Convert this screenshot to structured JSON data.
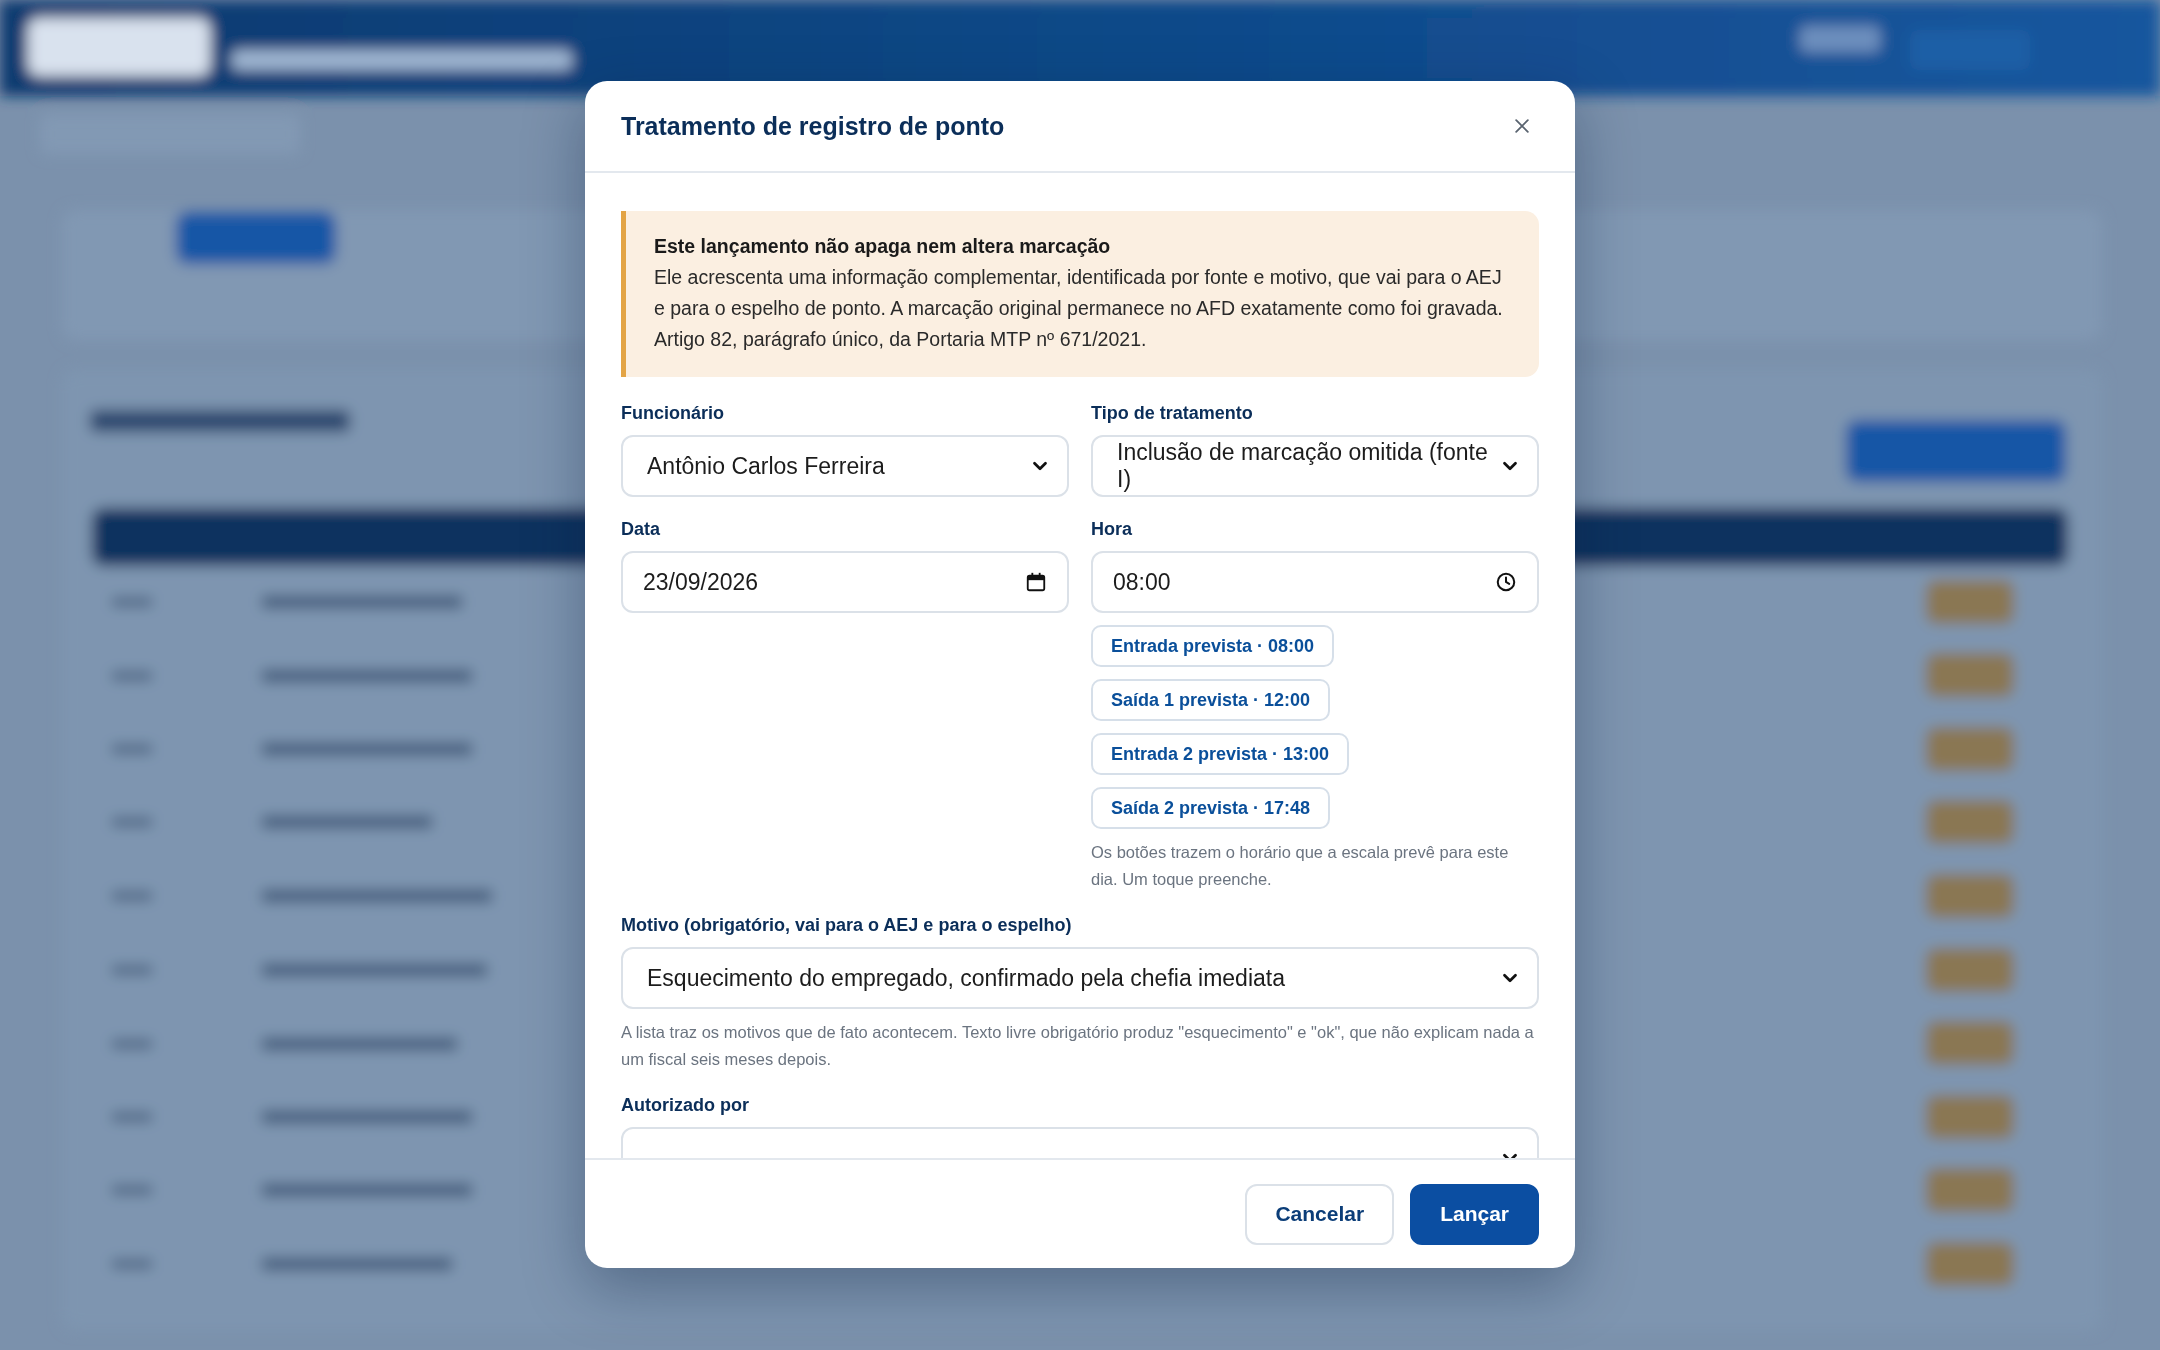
{
  "dialog": {
    "title": "Tratamento de registro de ponto"
  },
  "notice": {
    "title": "Este lançamento não apaga nem altera marcação",
    "text": "Ele acrescenta uma informação complementar, identificada por fonte e motivo, que vai para o AEJ e para o espelho de ponto. A marcação original permanece no AFD exatamente como foi gravada. Artigo 82, parágrafo único, da Portaria MTP nº 671/2021."
  },
  "rows": [
    [
      {
        "kind": "select",
        "label": "Funcionário",
        "value": "Antônio Carlos Ferreira"
      },
      {
        "kind": "select",
        "label": "Tipo de tratamento",
        "value": "Inclusão de marcação omitida (fonte I)"
      }
    ],
    [
      {
        "kind": "date",
        "label": "Data",
        "value": "23/09/2026"
      },
      {
        "kind": "time",
        "label": "Hora",
        "value": "08:00",
        "suggestions": [
          "Entrada prevista · 08:00",
          "Saída 1 prevista · 12:00",
          "Entrada 2 prevista · 13:00",
          "Saída 2 prevista · 17:48"
        ],
        "hint": "Os botões trazem o horário que a escala prevê para este dia. Um toque preenche."
      }
    ],
    [
      {
        "kind": "select",
        "label": "Motivo (obrigatório, vai para o AEJ e para o espelho)",
        "value": "Esquecimento do empregado, confirmado pela chefia imediata",
        "hint": "A lista traz os motivos que de fato acontecem. Texto livre obrigatório produz \"esquecimento\" e \"ok\", que não explicam nada a um fiscal seis meses depois."
      }
    ],
    [
      {
        "kind": "select",
        "label": "Autorizado por"
      }
    ]
  ],
  "buttons": [
    {
      "label": "Cancelar",
      "kind": "secondary"
    },
    {
      "label": "Lançar",
      "kind": "primary"
    }
  ]
}
